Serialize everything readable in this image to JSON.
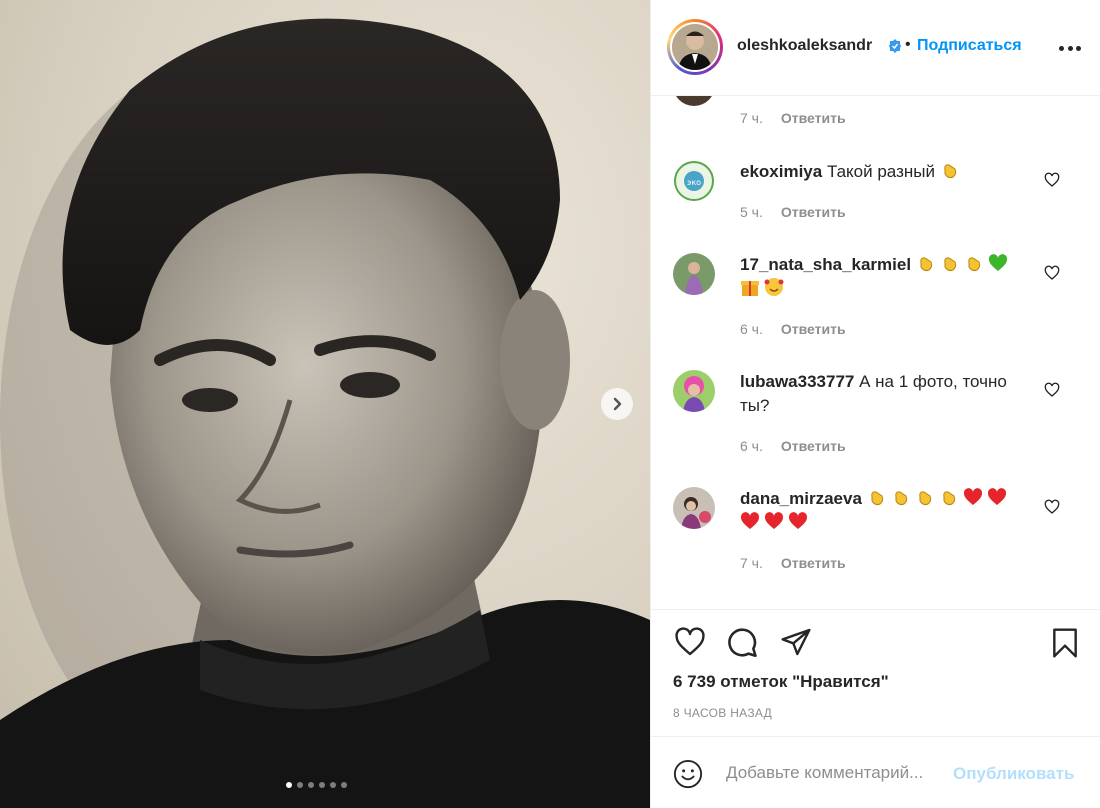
{
  "post": {
    "author": "oleshkoaleksandr",
    "separator": "•",
    "follow_label": "Подписаться",
    "more_icon": "more-horizontal-icon",
    "photo_count": 6,
    "active_photo": 1
  },
  "comments": [
    {
      "username": "",
      "text": "",
      "time": "7 ч.",
      "reply_label": "Ответить",
      "emojis": []
    },
    {
      "username": "ekoximiya",
      "text": "Такой разный",
      "time": "5 ч.",
      "reply_label": "Ответить",
      "emojis": [
        "clapping"
      ]
    },
    {
      "username": "17_nata_sha_karmiel",
      "text": "",
      "time": "6 ч.",
      "reply_label": "Ответить",
      "emojis": [
        "clapping",
        "clapping",
        "clapping",
        "green-heart",
        "gift",
        "smiling-hearts"
      ]
    },
    {
      "username": "lubawa333777",
      "text": "А на 1 фото, точно ты?",
      "time": "6 ч.",
      "reply_label": "Ответить",
      "emojis": []
    },
    {
      "username": "dana_mirzaeva",
      "text": "",
      "time": "7 ч.",
      "reply_label": "Ответить",
      "emojis": [
        "clapping",
        "clapping",
        "clapping",
        "clapping",
        "red-heart",
        "red-heart",
        "red-heart",
        "red-heart",
        "red-heart"
      ]
    }
  ],
  "likes_text": "6 739 отметок \"Нравится\"",
  "time_ago": "8 ЧАСОВ НАЗАД",
  "add_comment": {
    "placeholder": "Добавьте комментарий...",
    "publish_label": "Опубликовать"
  },
  "colors": {
    "accent": "#0095f6",
    "publish_disabled": "#b2dffc",
    "muted": "#8e8e8e",
    "text": "#262626"
  }
}
